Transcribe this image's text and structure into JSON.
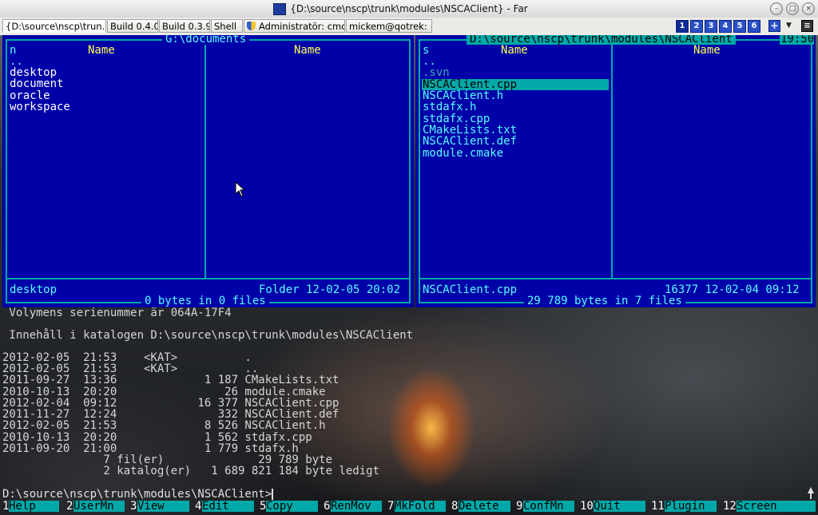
{
  "window": {
    "title": "{D:\\source\\nscp\\trunk\\modules\\NSCAClient} - Far"
  },
  "tabs": [
    {
      "label": "{D:\\source\\nscp\\trun..."
    },
    {
      "label": "Build 0.4.0"
    },
    {
      "label": "Build 0.3.9"
    },
    {
      "label": "Shell"
    },
    {
      "label": "Administratör: cmd"
    },
    {
      "label": "mickem@qotrek: ~"
    }
  ],
  "consoles": [
    "1",
    "2",
    "3",
    "4",
    "5",
    "6"
  ],
  "left_panel": {
    "title": "G:\\documents",
    "sort_indicator": "n",
    "col1_header": "Name",
    "col2_header": "Name",
    "files": [
      "..",
      "desktop",
      "document",
      "oracle",
      "workspace"
    ],
    "status_name": "desktop",
    "status_info": "Folder 12-02-05 20:02",
    "totals": "0 bytes in 0 files"
  },
  "right_panel": {
    "title": "D:\\source\\nscp\\trunk\\modules\\NSCAClient",
    "clock": "19:50",
    "sort_indicator": "s",
    "col1_header": "Name",
    "col2_header": "Name",
    "files": [
      "..",
      ".svn",
      "NSCAClient.cpp",
      "NSCAClient.h",
      "stdafx.h",
      "stdafx.cpp",
      "CMakeLists.txt",
      "NSCAClient.def",
      "module.cmake"
    ],
    "selected_index": 2,
    "status_name": "NSCAClient.cpp",
    "status_info": "16377 12-02-04 09:12",
    "totals": "29 789 bytes in 7 files"
  },
  "console_output": {
    "lines": [
      " Volymens serienummer är 064A-17F4",
      "",
      " Innehåll i katalogen D:\\source\\nscp\\trunk\\modules\\NSCAClient",
      "",
      "2012-02-05  21:53    <KAT>          .",
      "2012-02-05  21:53    <KAT>          ..",
      "2011-09-27  13:36             1 187 CMakeLists.txt",
      "2010-10-13  20:20                26 module.cmake",
      "2012-02-04  09:12            16 377 NSCAClient.cpp",
      "2011-11-27  12:24               332 NSCAClient.def",
      "2012-02-05  21:53             8 526 NSCAClient.h",
      "2010-10-13  20:20             1 562 stdafx.cpp",
      "2011-09-20  21:00             1 779 stdafx.h",
      "               7 fil(er)              29 789 byte",
      "               2 katalog(er)   1 689 821 184 byte ledigt"
    ],
    "prompt": "D:\\source\\nscp\\trunk\\modules\\NSCAClient>"
  },
  "fkeys": [
    {
      "num": "1",
      "label": "Help"
    },
    {
      "num": "2",
      "label": "UserMn"
    },
    {
      "num": "3",
      "label": "View"
    },
    {
      "num": "4",
      "label": "Edit"
    },
    {
      "num": "5",
      "label": "Copy"
    },
    {
      "num": "6",
      "label": "RenMov"
    },
    {
      "num": "7",
      "label": "MkFold"
    },
    {
      "num": "8",
      "label": "Delete"
    },
    {
      "num": "9",
      "label": "ConfMn"
    },
    {
      "num": "10",
      "label": "Quit"
    },
    {
      "num": "11",
      "label": "Plugin"
    },
    {
      "num": "12",
      "label": "Screen"
    }
  ],
  "colors": {
    "panel_bg": "#0000a8",
    "frame": "#00a8a8",
    "highlight": "#55ffff",
    "header": "#ffff55"
  }
}
